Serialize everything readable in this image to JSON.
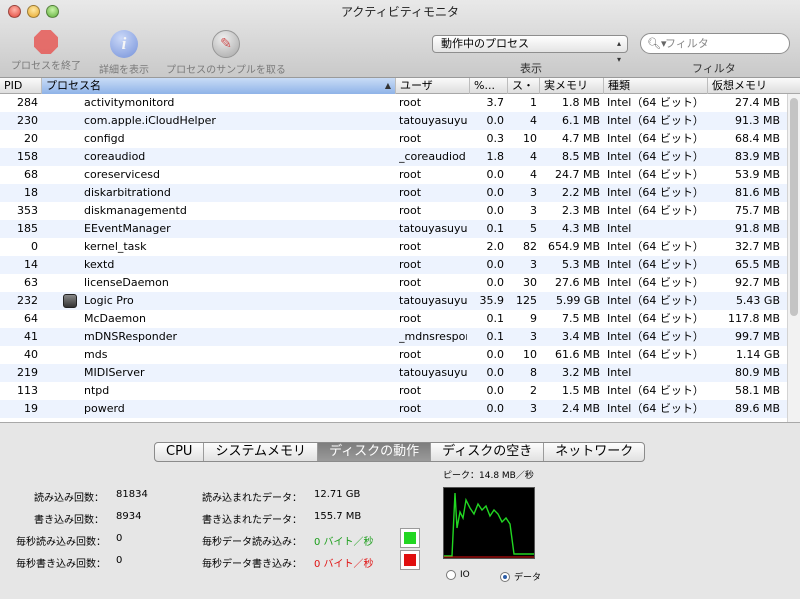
{
  "window": {
    "title": "アクティビティモニタ"
  },
  "toolbar": {
    "quit_label": "プロセスを終了",
    "inspect_label": "詳細を表示",
    "sample_label": "プロセスのサンプルを取る",
    "filter_select": {
      "value": "動作中のプロセス",
      "label": "表示"
    },
    "search": {
      "placeholder": "フィルタ",
      "label": "フィルタ"
    }
  },
  "columns": {
    "pid": "PID",
    "name": "プロセス名",
    "user": "ユーザ",
    "cpu": "%...",
    "threads": "ス・",
    "rmem": "実メモリ",
    "kind": "種類",
    "vmem": "仮想メモリ"
  },
  "processes": [
    {
      "pid": "284",
      "name": "activitymonitord",
      "user": "root",
      "cpu": "3.7",
      "threads": "1",
      "rmem": "1.8 MB",
      "kind": "Intel（64 ビット）",
      "vmem": "27.4 MB"
    },
    {
      "pid": "230",
      "name": "com.apple.iCloudHelper",
      "user": "tatouyasuyuki",
      "cpu": "0.0",
      "threads": "4",
      "rmem": "6.1 MB",
      "kind": "Intel（64 ビット）",
      "vmem": "91.3 MB"
    },
    {
      "pid": "20",
      "name": "configd",
      "user": "root",
      "cpu": "0.3",
      "threads": "10",
      "rmem": "4.7 MB",
      "kind": "Intel（64 ビット）",
      "vmem": "68.4 MB"
    },
    {
      "pid": "158",
      "name": "coreaudiod",
      "user": "_coreaudiod",
      "cpu": "1.8",
      "threads": "4",
      "rmem": "8.5 MB",
      "kind": "Intel（64 ビット）",
      "vmem": "83.9 MB"
    },
    {
      "pid": "68",
      "name": "coreservicesd",
      "user": "root",
      "cpu": "0.0",
      "threads": "4",
      "rmem": "24.7 MB",
      "kind": "Intel（64 ビット）",
      "vmem": "53.9 MB"
    },
    {
      "pid": "18",
      "name": "diskarbitrationd",
      "user": "root",
      "cpu": "0.0",
      "threads": "3",
      "rmem": "2.2 MB",
      "kind": "Intel（64 ビット）",
      "vmem": "81.6 MB"
    },
    {
      "pid": "353",
      "name": "diskmanagementd",
      "user": "root",
      "cpu": "0.0",
      "threads": "3",
      "rmem": "2.3 MB",
      "kind": "Intel（64 ビット）",
      "vmem": "75.7 MB"
    },
    {
      "pid": "185",
      "name": "EEventManager",
      "user": "tatouyasuyuki",
      "cpu": "0.1",
      "threads": "5",
      "rmem": "4.3 MB",
      "kind": "Intel",
      "vmem": "91.8 MB"
    },
    {
      "pid": "0",
      "name": "kernel_task",
      "user": "root",
      "cpu": "2.0",
      "threads": "82",
      "rmem": "654.9 MB",
      "kind": "Intel（64 ビット）",
      "vmem": "32.7 MB"
    },
    {
      "pid": "14",
      "name": "kextd",
      "user": "root",
      "cpu": "0.0",
      "threads": "3",
      "rmem": "5.3 MB",
      "kind": "Intel（64 ビット）",
      "vmem": "65.5 MB"
    },
    {
      "pid": "63",
      "name": "licenseDaemon",
      "user": "root",
      "cpu": "0.0",
      "threads": "30",
      "rmem": "27.6 MB",
      "kind": "Intel（64 ビット）",
      "vmem": "92.7 MB"
    },
    {
      "pid": "232",
      "name": "Logic Pro",
      "user": "tatouyasuyuki",
      "cpu": "35.9",
      "threads": "125",
      "rmem": "5.99 GB",
      "kind": "Intel（64 ビット）",
      "vmem": "5.43 GB",
      "icon": "logic-pro-icon"
    },
    {
      "pid": "64",
      "name": "McDaemon",
      "user": "root",
      "cpu": "0.1",
      "threads": "9",
      "rmem": "7.5 MB",
      "kind": "Intel（64 ビット）",
      "vmem": "117.8 MB"
    },
    {
      "pid": "41",
      "name": "mDNSResponder",
      "user": "_mdnsresponder",
      "cpu": "0.1",
      "threads": "3",
      "rmem": "3.4 MB",
      "kind": "Intel（64 ビット）",
      "vmem": "99.7 MB"
    },
    {
      "pid": "40",
      "name": "mds",
      "user": "root",
      "cpu": "0.0",
      "threads": "10",
      "rmem": "61.6 MB",
      "kind": "Intel（64 ビット）",
      "vmem": "1.14 GB"
    },
    {
      "pid": "219",
      "name": "MIDIServer",
      "user": "tatouyasuyuki",
      "cpu": "0.0",
      "threads": "8",
      "rmem": "3.2 MB",
      "kind": "Intel",
      "vmem": "80.9 MB"
    },
    {
      "pid": "113",
      "name": "ntpd",
      "user": "root",
      "cpu": "0.0",
      "threads": "2",
      "rmem": "1.5 MB",
      "kind": "Intel（64 ビット）",
      "vmem": "58.1 MB"
    },
    {
      "pid": "19",
      "name": "powerd",
      "user": "root",
      "cpu": "0.0",
      "threads": "3",
      "rmem": "2.4 MB",
      "kind": "Intel（64 ビット）",
      "vmem": "89.6 MB"
    }
  ],
  "tabs": [
    "CPU",
    "システムメモリ",
    "ディスクの動作",
    "ディスクの空き",
    "ネットワーク"
  ],
  "active_tab": "ディスクの動作",
  "disk": {
    "reads_in_label": "読み込み回数：",
    "reads_in": "81834",
    "writes_out_label": "書き込み回数：",
    "writes_out": "8934",
    "reads_per_sec_label": "毎秒読み込み回数：",
    "reads_per_sec": "0",
    "writes_per_sec_label": "毎秒書き込み回数：",
    "writes_per_sec": "0",
    "data_read_label": "読み込まれたデータ：",
    "data_read": "12.71 GB",
    "data_written_label": "書き込まれたデータ：",
    "data_written": "155.7 MB",
    "read_rate_label": "毎秒データ読み込み：",
    "read_rate": "0 バイト／秒",
    "write_rate_label": "毎秒データ書き込み：",
    "write_rate": "0 バイト／秒",
    "peak": "ピーク：14.8 MB／秒",
    "radio_io": "IO",
    "radio_data": "データ",
    "radio_selected": "データ",
    "colors": {
      "read": "#22d622",
      "write": "#e01010"
    }
  }
}
